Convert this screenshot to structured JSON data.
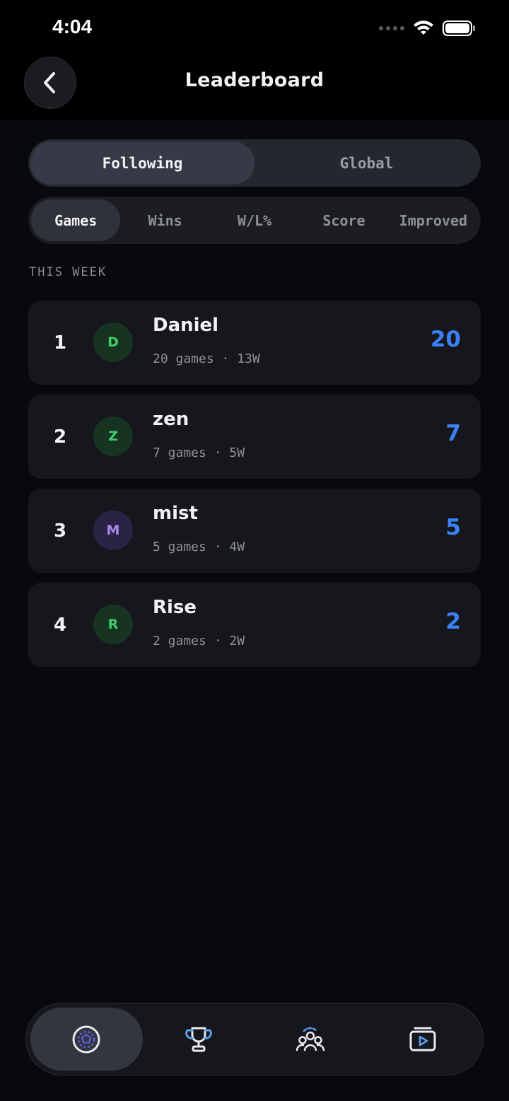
{
  "status_bar": {
    "time": "4:04"
  },
  "header": {
    "title": "Leaderboard"
  },
  "scope_tabs": [
    {
      "label": "Following",
      "active": true
    },
    {
      "label": "Global",
      "active": false
    }
  ],
  "metric_tabs": [
    {
      "label": "Games",
      "active": true
    },
    {
      "label": "Wins",
      "active": false
    },
    {
      "label": "W/L%",
      "active": false
    },
    {
      "label": "Score",
      "active": false
    },
    {
      "label": "Improved",
      "active": false
    }
  ],
  "section_label": "THIS WEEK",
  "entries": [
    {
      "rank": "1",
      "initial": "D",
      "name": "Daniel",
      "stats": "20 games · 13W",
      "score": "20",
      "avatar_bg": "#173321",
      "avatar_fg": "#3ecf6b"
    },
    {
      "rank": "2",
      "initial": "Z",
      "name": "zen",
      "stats": "7 games · 5W",
      "score": "7",
      "avatar_bg": "#173321",
      "avatar_fg": "#3ecf6b"
    },
    {
      "rank": "3",
      "initial": "M",
      "name": "mist",
      "stats": "5 games · 4W",
      "score": "5",
      "avatar_bg": "#2a2345",
      "avatar_fg": "#a98cf0"
    },
    {
      "rank": "4",
      "initial": "R",
      "name": "Rise",
      "stats": "2 games · 2W",
      "score": "2",
      "avatar_bg": "#173321",
      "avatar_fg": "#3ecf6b"
    }
  ],
  "colors": {
    "score_accent": "#3b82f6",
    "background": "#08090d",
    "card": "#16171c"
  },
  "bottom_nav": [
    {
      "icon": "soccer-ball-icon",
      "active": true
    },
    {
      "icon": "trophy-icon",
      "active": false
    },
    {
      "icon": "community-icon",
      "active": false
    },
    {
      "icon": "video-playlist-icon",
      "active": false
    }
  ]
}
